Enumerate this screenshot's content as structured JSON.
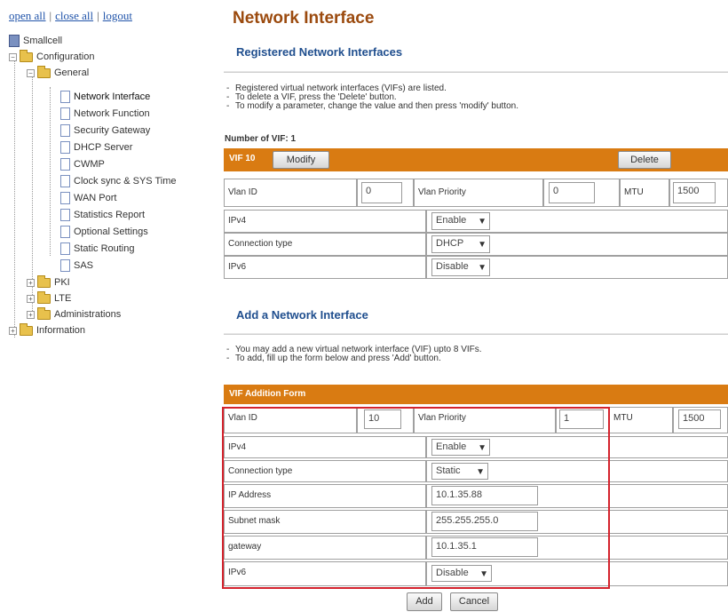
{
  "nav": {
    "top_links": {
      "open_all": "open all",
      "close_all": "close all",
      "logout": "logout",
      "separator": "|"
    },
    "tree": {
      "root": "Smallcell",
      "configuration": "Configuration",
      "general": "General",
      "general_items": [
        "Network Interface",
        "Network Function",
        "Security Gateway",
        "DHCP Server",
        "CWMP",
        "Clock sync & SYS Time",
        "WAN Port",
        "Statistics Report",
        "Optional Settings",
        "Static Routing",
        "SAS"
      ],
      "pki": "PKI",
      "lte": "LTE",
      "administrations": "Administrations",
      "information": "Information"
    }
  },
  "page": {
    "title": "Network Interface",
    "registered": {
      "heading": "Registered Network Interfaces",
      "notes": [
        "Registered virtual network interfaces (VIFs) are listed.",
        "To delete a VIF, press the 'Delete' button.",
        "To modify a parameter, change the value and then press 'modify' button."
      ],
      "count_label": "Number of VIF: 1",
      "vif_label": "VIF 10",
      "modify_button": "Modify",
      "delete_button": "Delete",
      "vlan_id_label": "Vlan ID",
      "vlan_id_value": "0",
      "vlan_priority_label": "Vlan Priority",
      "vlan_priority_value": "0",
      "mtu_label": "MTU",
      "mtu_value": "1500",
      "ipv4_label": "IPv4",
      "ipv4_value": "Enable",
      "conn_type_label": "Connection type",
      "conn_type_value": "DHCP",
      "ipv6_label": "IPv6",
      "ipv6_value": "Disable"
    },
    "add": {
      "heading": "Add a Network Interface",
      "notes": [
        "You may add a new virtual network interface (VIF) upto 8 VIFs.",
        "To add, fill up the form below and press 'Add' button."
      ],
      "form_title": "VIF Addition Form",
      "vlan_id_label": "Vlan ID",
      "vlan_id_value": "10",
      "vlan_priority_label": "Vlan Priority",
      "vlan_priority_value": "1",
      "mtu_label": "MTU",
      "mtu_value": "1500",
      "ipv4_label": "IPv4",
      "ipv4_value": "Enable",
      "conn_type_label": "Connection type",
      "conn_type_value": "Static",
      "ip_label": "IP Address",
      "ip_value": "10.1.35.88",
      "subnet_label": "Subnet mask",
      "subnet_value": "255.255.255.0",
      "gateway_label": "gateway",
      "gateway_value": "10.1.35.1",
      "ipv6_label": "IPv6",
      "ipv6_value": "Disable",
      "add_button": "Add",
      "cancel_button": "Cancel"
    }
  },
  "icons": {
    "expand": "plus-box-icon",
    "collapse": "minus-box-icon",
    "folder": "folder-icon",
    "page": "page-icon",
    "dropdown": "chevron-down-icon"
  },
  "colors": {
    "title": "#9b4a0e",
    "heading": "#1f4e8e",
    "bar": "#d97b12",
    "highlight": "#d4232d",
    "link": "#2255aa"
  }
}
